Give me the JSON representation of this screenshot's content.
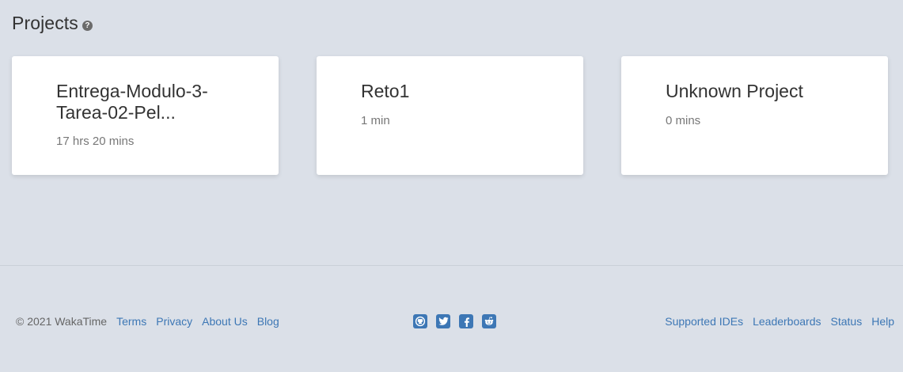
{
  "header": {
    "title": "Projects",
    "help_icon": "question-circle-icon"
  },
  "projects": [
    {
      "name": "Entrega-Modulo-3-Tarea-02-Pel...",
      "time": "17 hrs 20 mins"
    },
    {
      "name": "Reto1",
      "time": "1 min"
    },
    {
      "name": "Unknown Project",
      "time": "0 mins"
    }
  ],
  "footer": {
    "copyright": "© 2021 WakaTime",
    "left_links": [
      "Terms",
      "Privacy",
      "About Us",
      "Blog"
    ],
    "social_icons": [
      "github-icon",
      "twitter-icon",
      "facebook-icon",
      "reddit-icon"
    ],
    "right_links": [
      "Supported IDEs",
      "Leaderboards",
      "Status",
      "Help"
    ]
  },
  "colors": {
    "background": "#dbe0e8",
    "link": "#3d77b5",
    "card": "#ffffff"
  }
}
